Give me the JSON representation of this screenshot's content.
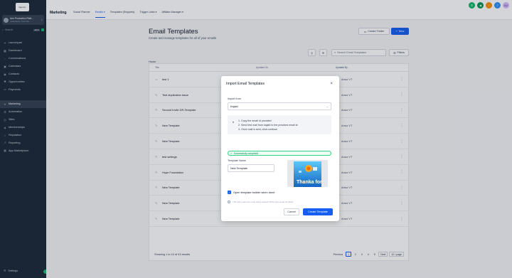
{
  "sidebar": {
    "logo": "Agency",
    "account_name": "Ann Production Platf...",
    "account_sub": "Indiankanal, Tech Ma...",
    "search_label": "Search",
    "search_kbd": "ctrl K",
    "items_top": [
      {
        "label": "Launchpad",
        "icon": "rocket-icon",
        "glyph": "✈"
      },
      {
        "label": "Dashboard",
        "icon": "dashboard-icon",
        "glyph": "▦"
      },
      {
        "label": "Conversations",
        "icon": "chat-icon",
        "glyph": "◌"
      },
      {
        "label": "Calendars",
        "icon": "calendar-icon",
        "glyph": "▣"
      },
      {
        "label": "Contacts",
        "icon": "contacts-icon",
        "glyph": "◉"
      },
      {
        "label": "Opportunities",
        "icon": "opportunities-icon",
        "glyph": "✱"
      },
      {
        "label": "Payments",
        "icon": "payments-icon",
        "glyph": "▭"
      }
    ],
    "items_bottom": [
      {
        "label": "Marketing",
        "icon": "send-icon",
        "glyph": "➤",
        "active": true
      },
      {
        "label": "Automation",
        "icon": "automation-icon",
        "glyph": "⚙"
      },
      {
        "label": "Sites",
        "icon": "globe-icon",
        "glyph": "◎"
      },
      {
        "label": "Memberships",
        "icon": "memberships-icon",
        "glyph": "◈"
      },
      {
        "label": "Reputation",
        "icon": "star-icon",
        "glyph": "☆"
      },
      {
        "label": "Reporting",
        "icon": "chart-icon",
        "glyph": "↗"
      },
      {
        "label": "App Marketplace",
        "icon": "grid-icon",
        "glyph": "▦"
      }
    ],
    "settings": "Settings"
  },
  "topbar": {
    "title": "Marketing",
    "tabs": [
      {
        "label": "Social Planner"
      },
      {
        "label": "Emails",
        "active": true
      },
      {
        "label": "Templates (Snippets)"
      },
      {
        "label": "Trigger Links"
      },
      {
        "label": "Affiliate Manager"
      }
    ],
    "avatar_initials": "AV"
  },
  "page": {
    "title": "Email Templates",
    "subtitle": "Create and manage templates for all of your emails",
    "create_folder": "Create Folder",
    "new_button": "New",
    "search_placeholder": "Search Email Templates",
    "filters": "Filters",
    "breadcrumb": "Home",
    "columns": [
      "Title",
      "Updated On",
      "Updated By"
    ],
    "rows": [
      {
        "name": "test 1",
        "type": "folder",
        "by": "Arraz VT"
      },
      {
        "name": "Test duplication issue",
        "type": "template",
        "by": "Arraz VT"
      },
      {
        "name": "Second Invite DR-Template",
        "type": "template",
        "by": "Arraz VT"
      },
      {
        "name": "New Template",
        "type": "template",
        "by": "Arraz VT"
      },
      {
        "name": "New Template",
        "type": "template",
        "by": "Arraz VT"
      },
      {
        "name": "test settings",
        "type": "template",
        "by": "Arraz VT"
      },
      {
        "name": "Hope Foundation",
        "type": "template",
        "by": "Arraz VT"
      },
      {
        "name": "New Template",
        "type": "template",
        "by": "Arraz VT"
      },
      {
        "name": "New Template",
        "type": "template",
        "by": "Arraz VT"
      },
      {
        "name": "New Template",
        "type": "template",
        "by": "Arraz VT"
      }
    ],
    "footer": "Showing 1 to 10 of 43 results",
    "pager": {
      "previous": "Previous",
      "pages": [
        "1",
        "2",
        "3",
        "4",
        "5"
      ],
      "next": "Next",
      "page_size": "10 / page"
    }
  },
  "modal": {
    "title": "Import Email Templates",
    "import_from_label": "Import from",
    "import_from_value": "Kajabi",
    "steps": [
      "Copy the email id provided",
      "Send test mail from kajabi to the provided email id",
      "Once mail is sent, click continue"
    ],
    "success": "Successfully completed",
    "template_name_label": "Template Name",
    "template_name_value": "New Template",
    "preview_text": "Thanka for",
    "checkbox_label": "Open template builder when done",
    "note": "This will create the code editor based HTML type email template",
    "cancel": "Cancel",
    "create": "Create Template"
  },
  "colors": {
    "primary": "#155eef",
    "sidebar": "#1d2939",
    "success": "#12b76a"
  }
}
